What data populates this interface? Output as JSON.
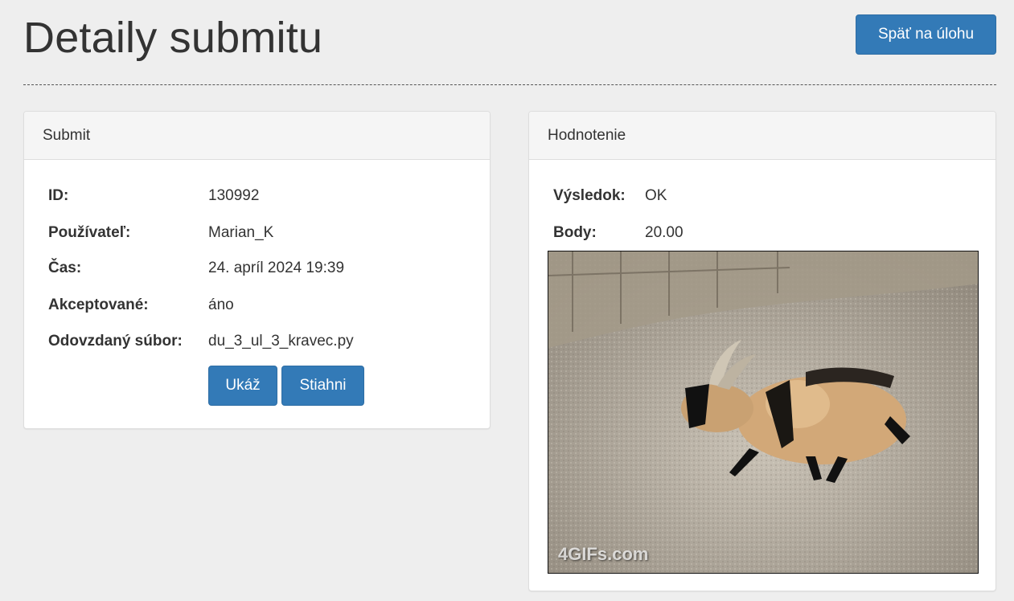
{
  "header": {
    "title": "Detaily submitu",
    "back_button": "Späť na úlohu"
  },
  "submit_panel": {
    "heading": "Submit",
    "fields": [
      {
        "label": "ID:",
        "value": "130992"
      },
      {
        "label": "Používateľ:",
        "value": "Marian_K"
      },
      {
        "label": "Čas:",
        "value": "24. apríl 2024 19:39"
      },
      {
        "label": "Akceptované:",
        "value": "áno"
      },
      {
        "label": "Odovzdaný súbor:",
        "value": "du_3_ul_3_kravec.py"
      }
    ],
    "show_button": "Ukáž",
    "download_button": "Stiahni"
  },
  "evaluation_panel": {
    "heading": "Hodnotenie",
    "fields": [
      {
        "label": "Výsledok:",
        "value": "OK"
      },
      {
        "label": "Body:",
        "value": "20.00"
      }
    ],
    "image": {
      "description_icon": "goat-running-gif",
      "watermark": "4GIFs.com"
    }
  },
  "colors": {
    "primary": "#337ab7",
    "background": "#eeeeee"
  }
}
